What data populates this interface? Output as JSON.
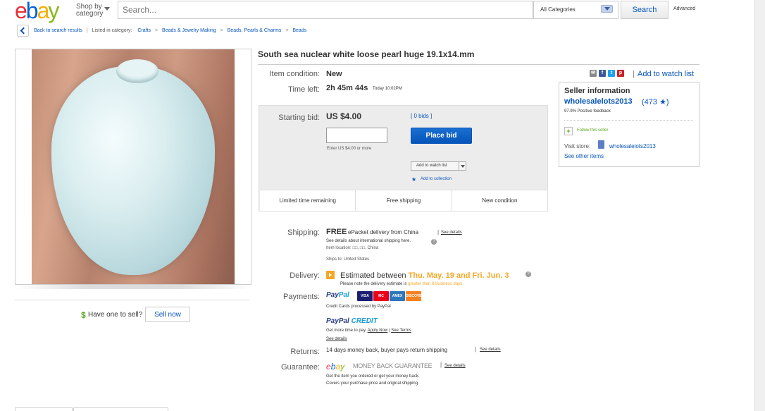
{
  "header": {
    "logo": [
      "e",
      "b",
      "a",
      "y"
    ],
    "shop_by_line1": "Shop by",
    "shop_by_line2": "category",
    "search_placeholder": "Search...",
    "category_select": "All Categories",
    "search_button": "Search",
    "advanced": "Advanced"
  },
  "breadcrumb": {
    "back": "Back to search results",
    "bar": "|",
    "listed": "Listed in category:",
    "items": [
      "Crafts",
      "Beads & Jewelry Making",
      "Beads, Pearls & Charms",
      "Beads"
    ],
    "separator": ">"
  },
  "item": {
    "title": "South sea nuclear white loose pearl huge 19.1x14.mm",
    "condition_label": "Item condition:",
    "condition_value": "New",
    "time_label": "Time left:",
    "time_value": "2h 45m 44s",
    "time_end": "Today 10:02PM"
  },
  "bid": {
    "label": "Starting bid:",
    "price": "US $4.00",
    "bids_link": "[ 0 bids ]",
    "input_value": "",
    "hint": "Enter US $4.00 or more",
    "place_bid": "Place bid",
    "watch_dropdown": "Add to watch list",
    "collection_star": "★",
    "collection": "Add to collection",
    "features": [
      "Limited time remaining",
      "Free shipping",
      "New condition"
    ]
  },
  "seller": {
    "share_icons": [
      "email-icon",
      "facebook-icon",
      "twitter-icon",
      "pinterest-icon"
    ],
    "share_separator": "|",
    "watch_link": "Add to watch list",
    "heading": "Seller information",
    "name": "wholesalelots2013",
    "score": "(473 ★)",
    "feedback": "97.9% Positive feedback",
    "follow_icon": "+",
    "follow": "Follow this seller",
    "visit_label": "Visit store:",
    "store_name": "wholesalelots2013",
    "other_items": "See other items"
  },
  "shipping": {
    "label": "Shipping:",
    "free": "FREE",
    "method": "ePacket delivery from China",
    "bar": "|",
    "see_details": "See details",
    "intl_note": "See details about international shipping here.",
    "help": "?",
    "item_location": "Item location: □□, □□, China",
    "ships_to": "Ships to: United States"
  },
  "delivery": {
    "label": "Delivery:",
    "estimated_prefix": "Estimated between",
    "estimated_dates": "Thu. May. 19 and Fri. Jun. 3",
    "help": "?",
    "note_prefix": "Please note the delivery estimate is",
    "note_highlight": "greater than 8 business days."
  },
  "payments": {
    "label": "Payments:",
    "paypal_1": "Pay",
    "paypal_2": "Pal",
    "cards": [
      "VISA",
      "MC",
      "AMEX",
      "DISCOVER"
    ],
    "cc_note": "Credit Cards processed by PayPal",
    "credit_1": "PayPal",
    "credit_2": "CREDIT",
    "credit_text": "Get more time to pay.",
    "apply_now": "Apply Now",
    "credit_bar": "|",
    "see_terms": "See Terms",
    "see_details": "See details"
  },
  "returns": {
    "label": "Returns:",
    "text": "14 days money back, buyer pays return shipping",
    "bar": "|",
    "see_details": "See details"
  },
  "guarantee": {
    "label": "Guarantee:",
    "logo": [
      "e",
      "b",
      "a",
      "y"
    ],
    "mbg": "MONEY BACK GUARANTEE",
    "bar": "|",
    "see_details": "See details",
    "note1": "Get the item you ordered or get your money back.",
    "note2": "Covers your purchase price and original shipping."
  },
  "sell": {
    "dollar": "$",
    "text": "Have one to sell?",
    "button": "Sell now"
  },
  "colors": {
    "link": "#0654ba",
    "place_bid": "#0654ba",
    "highlight": "#f5a623",
    "follow_green": "#5ba71b"
  }
}
